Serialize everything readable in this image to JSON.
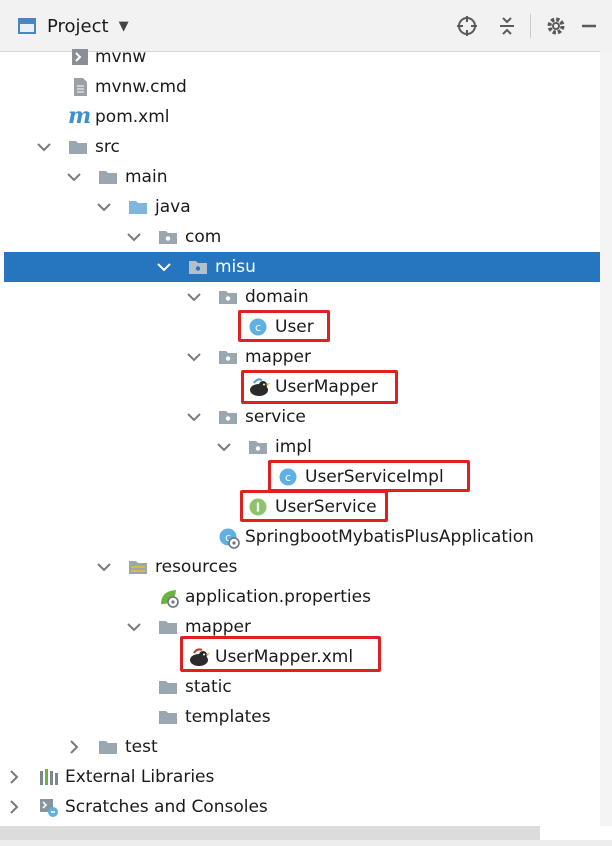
{
  "header": {
    "title": "Project",
    "caret": "▼",
    "icons": [
      "crosshair-icon",
      "collapse-all-icon",
      "gear-icon",
      "minimize-icon"
    ]
  },
  "tree": {
    "items": [
      {
        "label": "mvnw",
        "icon": "script-file-icon",
        "expanded": null
      },
      {
        "label": "mvnw.cmd",
        "icon": "text-file-icon",
        "expanded": null
      },
      {
        "label": "pom.xml",
        "icon": "maven-icon",
        "expanded": null
      },
      {
        "label": "src",
        "icon": "folder-icon",
        "expanded": true
      },
      {
        "label": "main",
        "icon": "folder-icon",
        "expanded": true
      },
      {
        "label": "java",
        "icon": "source-folder-icon",
        "expanded": true
      },
      {
        "label": "com",
        "icon": "package-icon",
        "expanded": true
      },
      {
        "label": "misu",
        "icon": "package-icon",
        "expanded": true,
        "selected": true
      },
      {
        "label": "domain",
        "icon": "package-icon",
        "expanded": true
      },
      {
        "label": "User",
        "icon": "class-icon",
        "expanded": null,
        "highlighted": true
      },
      {
        "label": "mapper",
        "icon": "package-icon",
        "expanded": true
      },
      {
        "label": "UserMapper",
        "icon": "mybatis-bird-icon",
        "expanded": null,
        "highlighted": true
      },
      {
        "label": "service",
        "icon": "package-icon",
        "expanded": true
      },
      {
        "label": "impl",
        "icon": "package-icon",
        "expanded": true
      },
      {
        "label": "UserServiceImpl",
        "icon": "class-icon",
        "expanded": null,
        "highlighted": true
      },
      {
        "label": "UserService",
        "icon": "interface-icon",
        "expanded": null,
        "highlighted": true
      },
      {
        "label": "SpringbootMybatisPlusApplication",
        "icon": "spring-class-icon",
        "expanded": null
      },
      {
        "label": "resources",
        "icon": "resources-folder-icon",
        "expanded": true
      },
      {
        "label": "application.properties",
        "icon": "spring-properties-icon",
        "expanded": null
      },
      {
        "label": "mapper",
        "icon": "folder-icon",
        "expanded": true
      },
      {
        "label": "UserMapper.xml",
        "icon": "mybatis-bird-icon",
        "expanded": null,
        "highlighted": true
      },
      {
        "label": "static",
        "icon": "folder-icon",
        "expanded": null
      },
      {
        "label": "templates",
        "icon": "folder-icon",
        "expanded": null
      },
      {
        "label": "test",
        "icon": "folder-icon",
        "expanded": false
      },
      {
        "label": "External Libraries",
        "icon": "libraries-icon",
        "expanded": false
      },
      {
        "label": "Scratches and Consoles",
        "icon": "scratches-icon",
        "expanded": false
      }
    ]
  },
  "colors": {
    "selection": "#2675bf",
    "highlight_border": "#e02020",
    "folder": "#9aa7b0",
    "source_folder": "#7fb6e0",
    "class_icon": "#5eb1e3",
    "interface_icon": "#8fc46c",
    "spring": "#6db33f"
  }
}
